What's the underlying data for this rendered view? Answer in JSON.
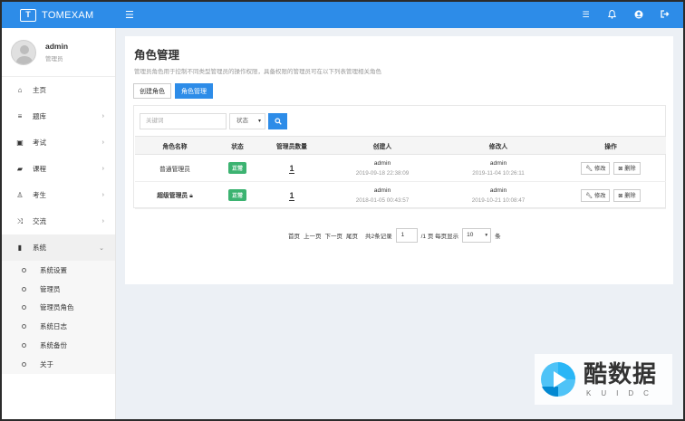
{
  "topbar": {
    "logo_glyph": "T",
    "brand": "TOMEXAM",
    "menu_icon": "hamburger-icon",
    "icons": [
      "list-icon",
      "bell-icon",
      "user-circle-icon",
      "logout-icon"
    ]
  },
  "user": {
    "name": "admin",
    "role": "管理员"
  },
  "sidebar": {
    "items": [
      {
        "label": "主页",
        "icon": "home-icon",
        "has_children": false
      },
      {
        "label": "题库",
        "icon": "database-icon",
        "has_children": true
      },
      {
        "label": "考试",
        "icon": "calendar-icon",
        "has_children": true
      },
      {
        "label": "课程",
        "icon": "book-icon",
        "has_children": true
      },
      {
        "label": "考生",
        "icon": "user-icon",
        "has_children": true
      },
      {
        "label": "交流",
        "icon": "shuffle-icon",
        "has_children": true
      },
      {
        "label": "系统",
        "icon": "server-icon",
        "has_children": true,
        "expanded": true
      }
    ],
    "subitems": [
      "系统设置",
      "管理员",
      "管理员角色",
      "系统日志",
      "系统备份",
      "关于"
    ]
  },
  "page": {
    "title": "角色管理",
    "description": "管理员角色用于控制不同类型管理员的操作权限，具备权限的管理员可在以下列表管理相关角色",
    "tabs": [
      {
        "label": "创建角色",
        "active": false
      },
      {
        "label": "角色管理",
        "active": true
      }
    ]
  },
  "filters": {
    "keyword_placeholder": "关键词",
    "status_select": "状态",
    "search_icon": "search-icon"
  },
  "table": {
    "headers": [
      "角色名称",
      "状态",
      "管理员数量",
      "创建人",
      "修改人",
      "操作"
    ],
    "rows": [
      {
        "name": "普通管理员",
        "locked": false,
        "status": "正常",
        "count": "1",
        "creator": "admin",
        "created": "2019-09-18 22:38:09",
        "modifier": "admin",
        "modified": "2019-11-04 10:26:11",
        "edit": "修改",
        "delete": "删除"
      },
      {
        "name": "超级管理员",
        "locked": true,
        "status": "正常",
        "count": "1",
        "creator": "admin",
        "created": "2018-01-05 00:43:57",
        "modifier": "admin",
        "modified": "2019-10-21 10:08:47",
        "edit": "修改",
        "delete": "删除"
      }
    ]
  },
  "pager": {
    "first": "首页",
    "prev": "上一页",
    "next": "下一页",
    "last": "尾页",
    "total": "共2条记录",
    "current_page": "1",
    "pages_label": "/1 页 每页显示",
    "page_size": "10",
    "unit": "条"
  },
  "watermark": {
    "main": "酷数据",
    "sub": "KUIDC"
  },
  "colors": {
    "primary": "#2d8ce8",
    "success": "#3cb371"
  }
}
